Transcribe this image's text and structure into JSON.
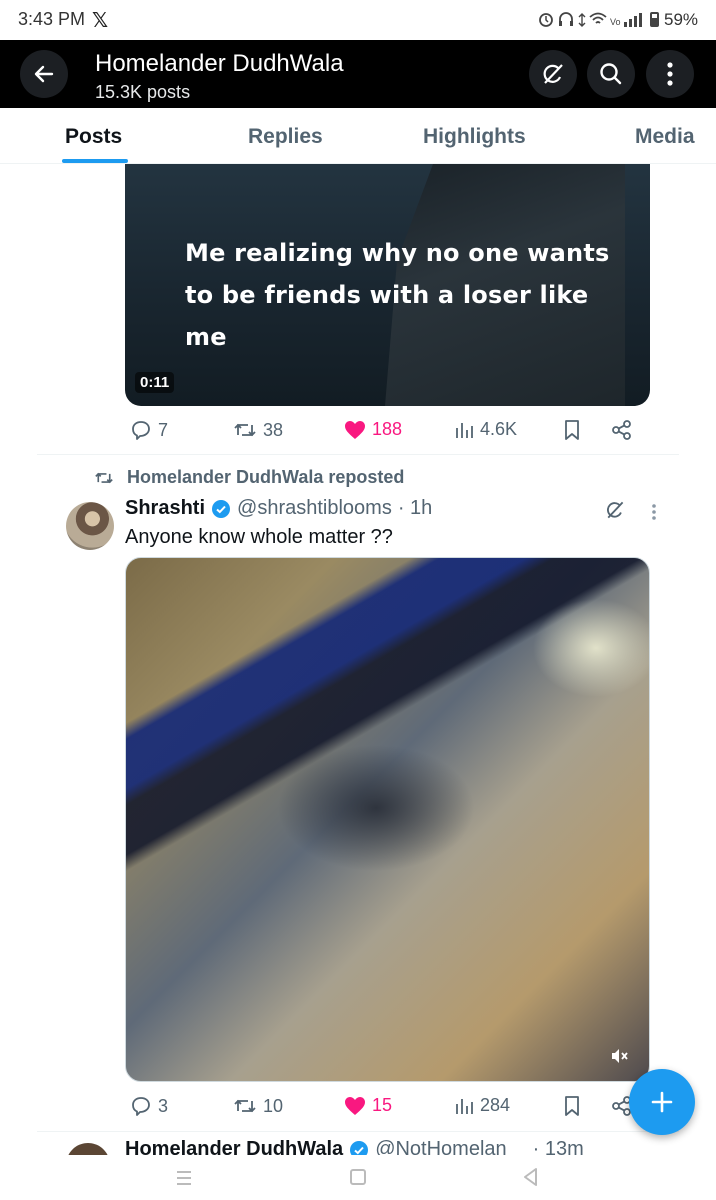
{
  "status_bar": {
    "time": "3:43 PM",
    "x_logo": "𝕏",
    "battery": "59%"
  },
  "header": {
    "title": "Homelander DudhWala",
    "post_count": "15.3K posts"
  },
  "tabs": [
    {
      "label": "Posts",
      "active": true
    },
    {
      "label": "Replies",
      "active": false
    },
    {
      "label": "Highlights",
      "active": false
    },
    {
      "label": "Media",
      "active": false
    }
  ],
  "post1": {
    "media_caption": "Me realizing why no one wants to be friends with a loser like me",
    "duration": "0:11",
    "replies": "7",
    "reposts": "38",
    "likes": "188",
    "views": "4.6K"
  },
  "post2": {
    "repost_label": "Homelander DudhWala reposted",
    "author_name": "Shrashti",
    "handle": "@shrashtiblooms",
    "time": "· 1h",
    "text": "Anyone know whole matter ??",
    "replies": "3",
    "reposts": "10",
    "likes": "15",
    "views": "284"
  },
  "post3": {
    "author_name": "Homelander DudhWala",
    "handle": "@NotHomelan",
    "time": "· 13m"
  },
  "colors": {
    "accent": "#1d9bf0",
    "like": "#f91880",
    "secondary_text": "#536471"
  }
}
